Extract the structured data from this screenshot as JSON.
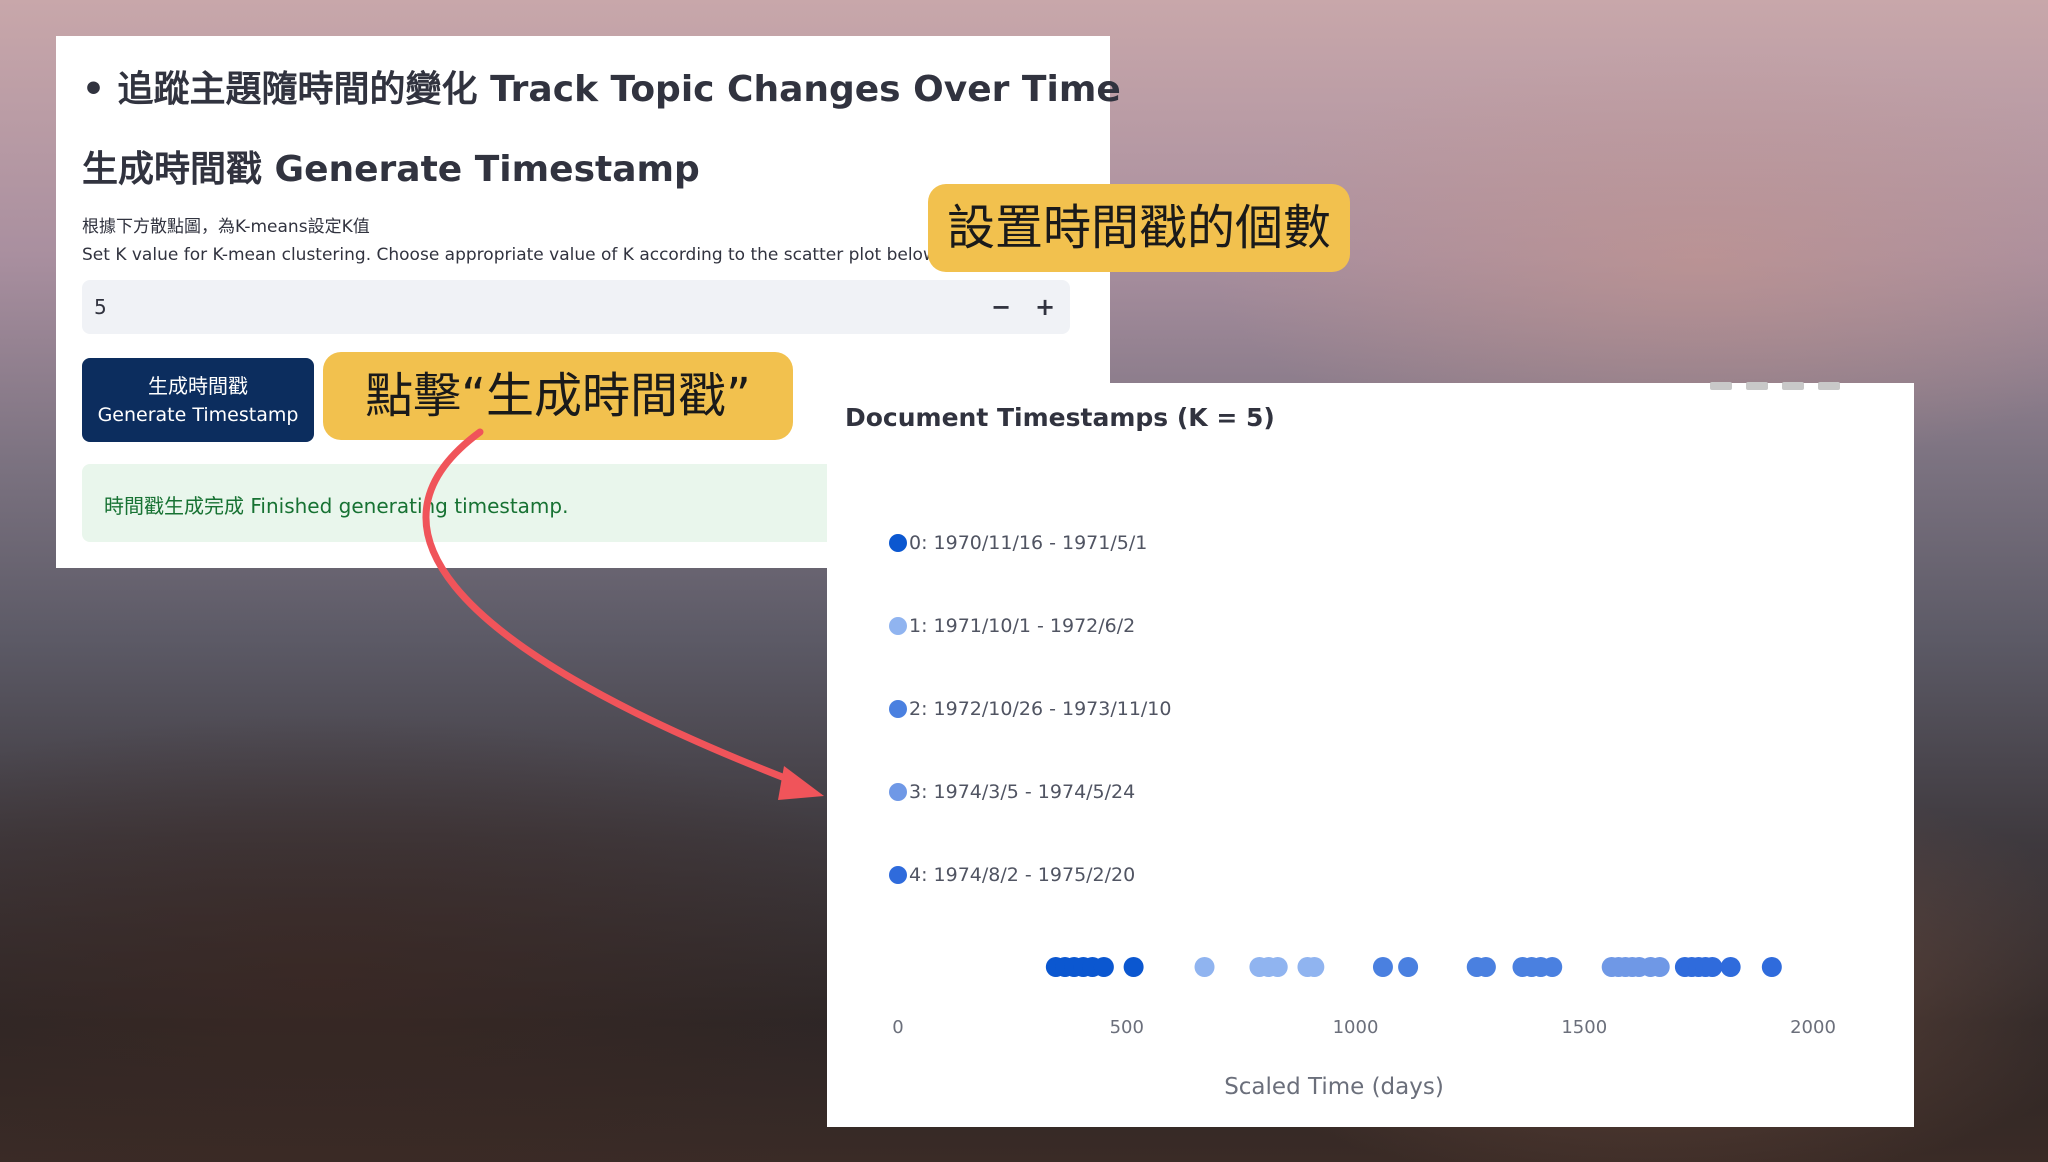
{
  "left_panel": {
    "heading": "• 追蹤主題隨時間的變化 Track Topic Changes Over Time",
    "subheading": "生成時間戳 Generate Timestamp",
    "help_zh": "根據下方散點圖，為K-means設定K值",
    "help_en": "Set K value for K-mean clustering. Choose appropriate value of K according to the scatter plot below",
    "k_input": {
      "value": "5",
      "minus": "−",
      "plus": "+"
    },
    "button": {
      "line1": "生成時間戳",
      "line2": "Generate Timestamp"
    },
    "success_message": "時間戳生成完成 Finished generating timestamp."
  },
  "callouts": {
    "set_count": "設置時間戳的個數",
    "click_generate": "點擊“生成時間戳”",
    "color": "#f2c14e",
    "arrow_color": "#f0545a"
  },
  "chart_data": {
    "type": "scatter",
    "title": "Document Timestamps (K = 5)",
    "xlabel": "Scaled Time (days)",
    "ylabel": "",
    "xlim": [
      0,
      2000
    ],
    "x_ticks": [
      "0",
      "500",
      "1000",
      "1500",
      "2000"
    ],
    "legend_placement": "left",
    "grid": false,
    "series": [
      {
        "name": "0: 1970/11/16 - 1971/5/1",
        "color": "#0b57d0",
        "x": [
          345,
          365,
          385,
          405,
          425,
          450,
          515
        ]
      },
      {
        "name": "1: 1971/10/1 - 1972/6/2",
        "color": "#90b4f0",
        "x": [
          670,
          790,
          810,
          830,
          895,
          910
        ]
      },
      {
        "name": "2: 1972/10/26 - 1973/11/10",
        "color": "#4a80e0",
        "x": [
          1060,
          1115,
          1265,
          1285,
          1365,
          1385,
          1405,
          1430
        ]
      },
      {
        "name": "3: 1974/3/5 - 1974/5/24",
        "color": "#6f98e6",
        "x": [
          1560,
          1575,
          1590,
          1605,
          1620,
          1645,
          1665
        ]
      },
      {
        "name": "4: 1974/8/2 - 1975/2/20",
        "color": "#2f6bdc",
        "x": [
          1720,
          1735,
          1750,
          1765,
          1780,
          1820,
          1910
        ]
      }
    ]
  }
}
